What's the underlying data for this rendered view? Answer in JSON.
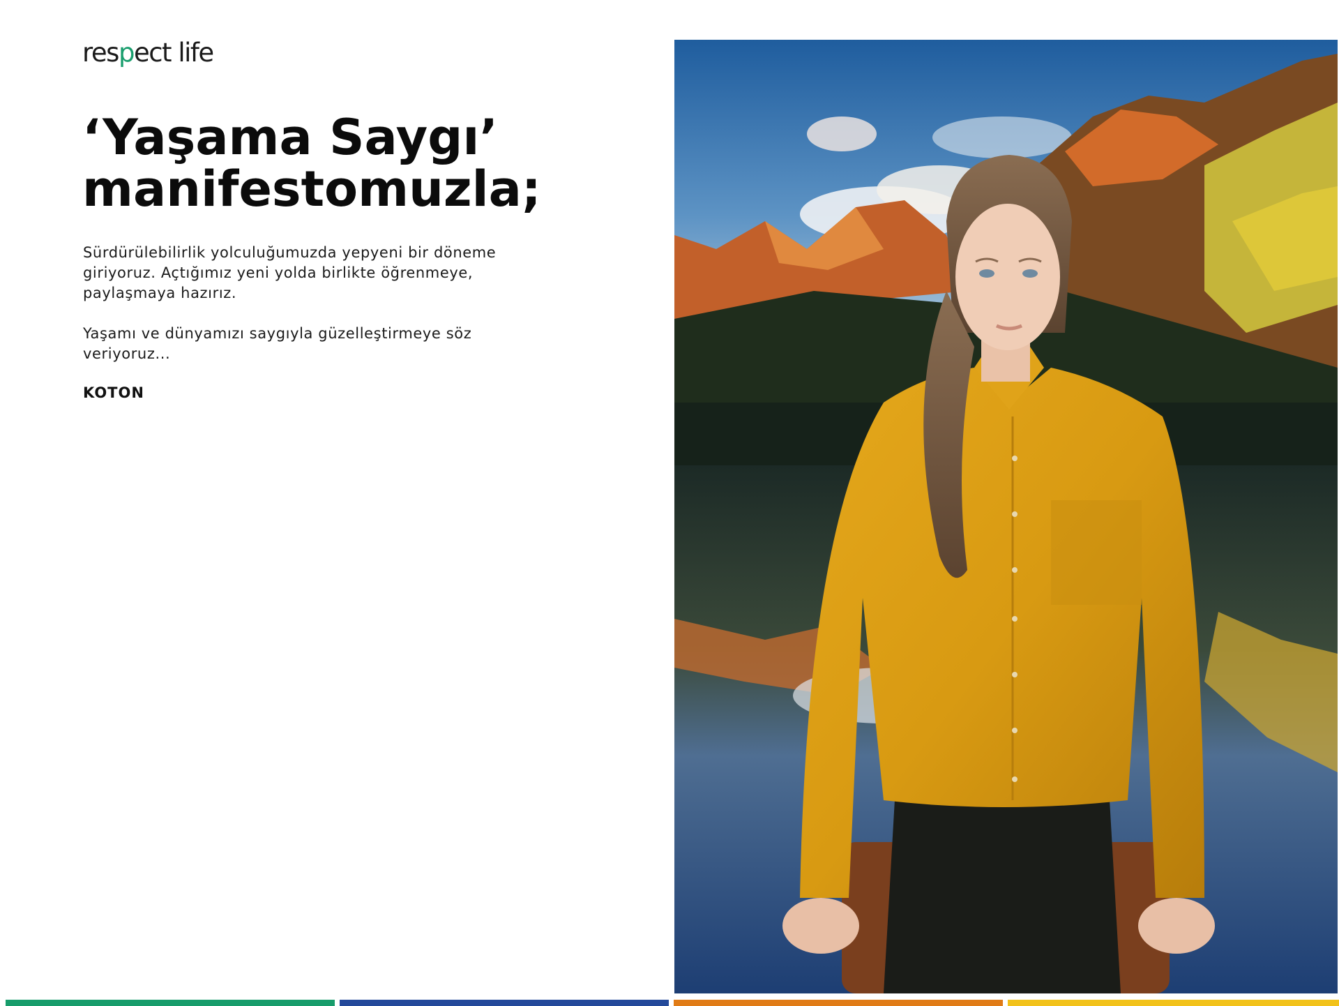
{
  "logo": {
    "part1": "res",
    "dot_letter": "p",
    "part2": "ect life",
    "accent_color": "#1a9e6e"
  },
  "headline": {
    "line1": "‘Yaşama Saygı’",
    "line2": "manifestomuzla;"
  },
  "paragraph1": {
    "line1": "Sürdürülebilirlik yolculuğumuzda yepyeni bir döneme",
    "line2": "giriyoruz. Açtığımız yeni yolda birlikte öğrenmeye,",
    "line3": "paylaşmaya hazırız."
  },
  "paragraph2": {
    "line1": "Yaşamı ve dünyamızı saygıyla güzelleştirmeye söz",
    "line2": "veriyoruz..."
  },
  "signature": "KOTON",
  "photo": {
    "subject": "woman-in-mustard-shirt",
    "background": "mountain-lake-sunset"
  },
  "bars": {
    "colors": [
      "#179c6b",
      "#23499a",
      "#e07b16",
      "#f2c21a"
    ]
  }
}
